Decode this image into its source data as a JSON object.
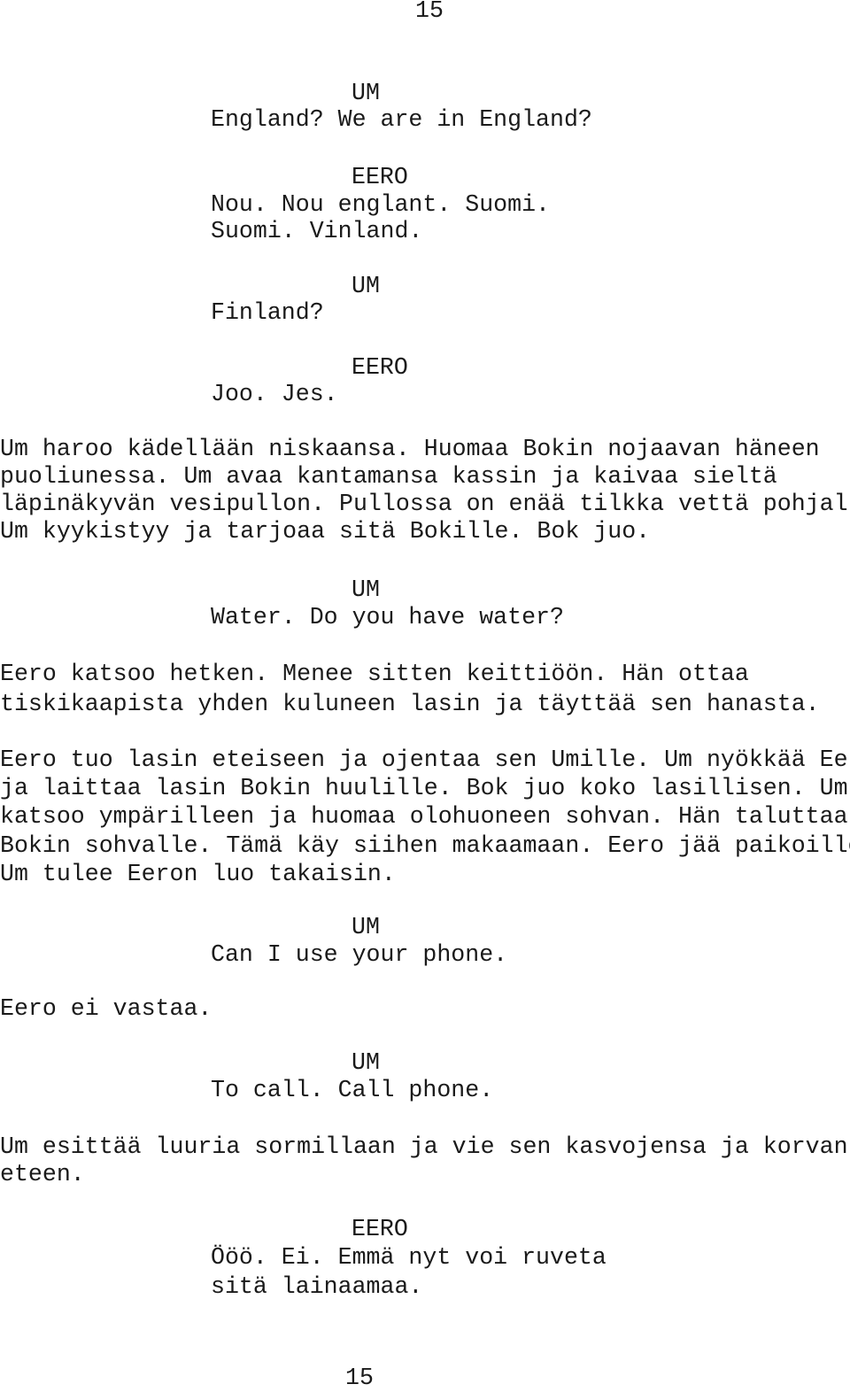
{
  "page_number_top": "15",
  "page_number_bottom": "15",
  "blocks": [
    {
      "type": "dialogue",
      "character": "UM",
      "lines": [
        "England? We are in England?"
      ]
    },
    {
      "type": "dialogue",
      "character": "EERO",
      "lines": [
        "Nou. Nou englant. Suomi.",
        "Suomi. Vinland."
      ]
    },
    {
      "type": "dialogue",
      "character": "UM",
      "lines": [
        "Finland?"
      ]
    },
    {
      "type": "dialogue",
      "character": "EERO",
      "lines": [
        "Joo. Jes."
      ]
    },
    {
      "type": "action",
      "lines": [
        "Um haroo kädellään niskaansa. Huomaa Bokin nojaavan häneen",
        "puoliunessa. Um avaa kantamansa kassin ja kaivaa sieltä",
        "läpinäkyvän vesipullon. Pullossa on enää tilkka vettä pohjalla.",
        "Um kyykistyy ja tarjoaa sitä Bokille. Bok juo."
      ]
    },
    {
      "type": "dialogue",
      "character": "UM",
      "lines": [
        "Water. Do you have water?"
      ]
    },
    {
      "type": "action",
      "lines": [
        "Eero katsoo hetken. Menee sitten keittiöön. Hän ottaa",
        "tiskikaapista yhden kuluneen lasin ja täyttää sen hanasta."
      ]
    },
    {
      "type": "action",
      "lines": [
        "Eero tuo lasin eteiseen ja ojentaa sen Umille. Um nyökkää Eerolle",
        "ja laittaa lasin Bokin huulille. Bok juo koko lasillisen. Um",
        "katsoo ympärilleen ja huomaa olohuoneen sohvan. Hän taluttaa",
        "Bokin sohvalle. Tämä käy siihen makaamaan. Eero jää paikoilleen.",
        "Um tulee Eeron luo takaisin."
      ]
    },
    {
      "type": "dialogue",
      "character": "UM",
      "lines": [
        "Can I use your phone."
      ]
    },
    {
      "type": "action",
      "lines": [
        "Eero ei vastaa."
      ]
    },
    {
      "type": "dialogue",
      "character": "UM",
      "lines": [
        "To call. Call phone."
      ]
    },
    {
      "type": "action",
      "lines": [
        "Um esittää luuria sormillaan ja vie sen kasvojensa ja korvan",
        "eteen."
      ]
    },
    {
      "type": "dialogue",
      "character": "EERO",
      "lines": [
        "Ööö. Ei. Emmä nyt voi ruveta",
        "sitä lainaamaa."
      ]
    }
  ]
}
